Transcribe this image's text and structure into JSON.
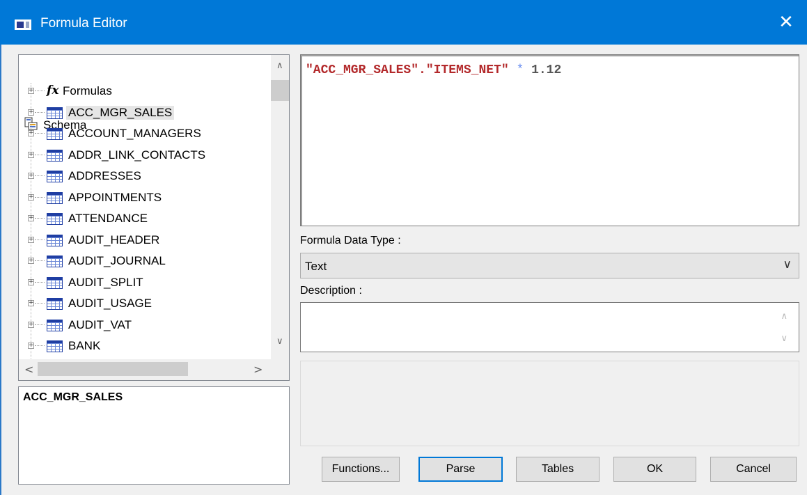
{
  "window": {
    "title": "Formula Editor",
    "close_glyph": "✕"
  },
  "tree": {
    "root_label": "Schema",
    "formulas_label": "Formulas",
    "tables": [
      "ACC_MGR_SALES",
      "ACCOUNT_MANAGERS",
      "ADDR_LINK_CONTACTS",
      "ADDRESSES",
      "APPOINTMENTS",
      "ATTENDANCE",
      "AUDIT_HEADER",
      "AUDIT_JOURNAL",
      "AUDIT_SPLIT",
      "AUDIT_USAGE",
      "AUDIT_VAT",
      "BANK"
    ],
    "selected": "ACC_MGR_SALES"
  },
  "detail": {
    "text": "ACC_MGR_SALES"
  },
  "editor": {
    "tokens": [
      {
        "text": "\"ACC_MGR_SALES\".\"ITEMS_NET\"",
        "kind": "str"
      },
      {
        "text": " * ",
        "kind": "op"
      },
      {
        "text": "1.12",
        "kind": "num"
      }
    ]
  },
  "data_type": {
    "label": "Formula Data Type :",
    "value": "Text"
  },
  "description": {
    "label": "Description :"
  },
  "buttons": {
    "functions": "Functions...",
    "parse": "Parse",
    "tables": "Tables",
    "ok": "OK",
    "cancel": "Cancel"
  },
  "colors": {
    "titlebar": "#0078d7",
    "string_token": "#b3292b",
    "operator_token": "#6a8ef0"
  },
  "icons": {
    "close": "close-icon",
    "schema": "schema-icon",
    "formula": "fx-icon",
    "table": "table-icon"
  }
}
